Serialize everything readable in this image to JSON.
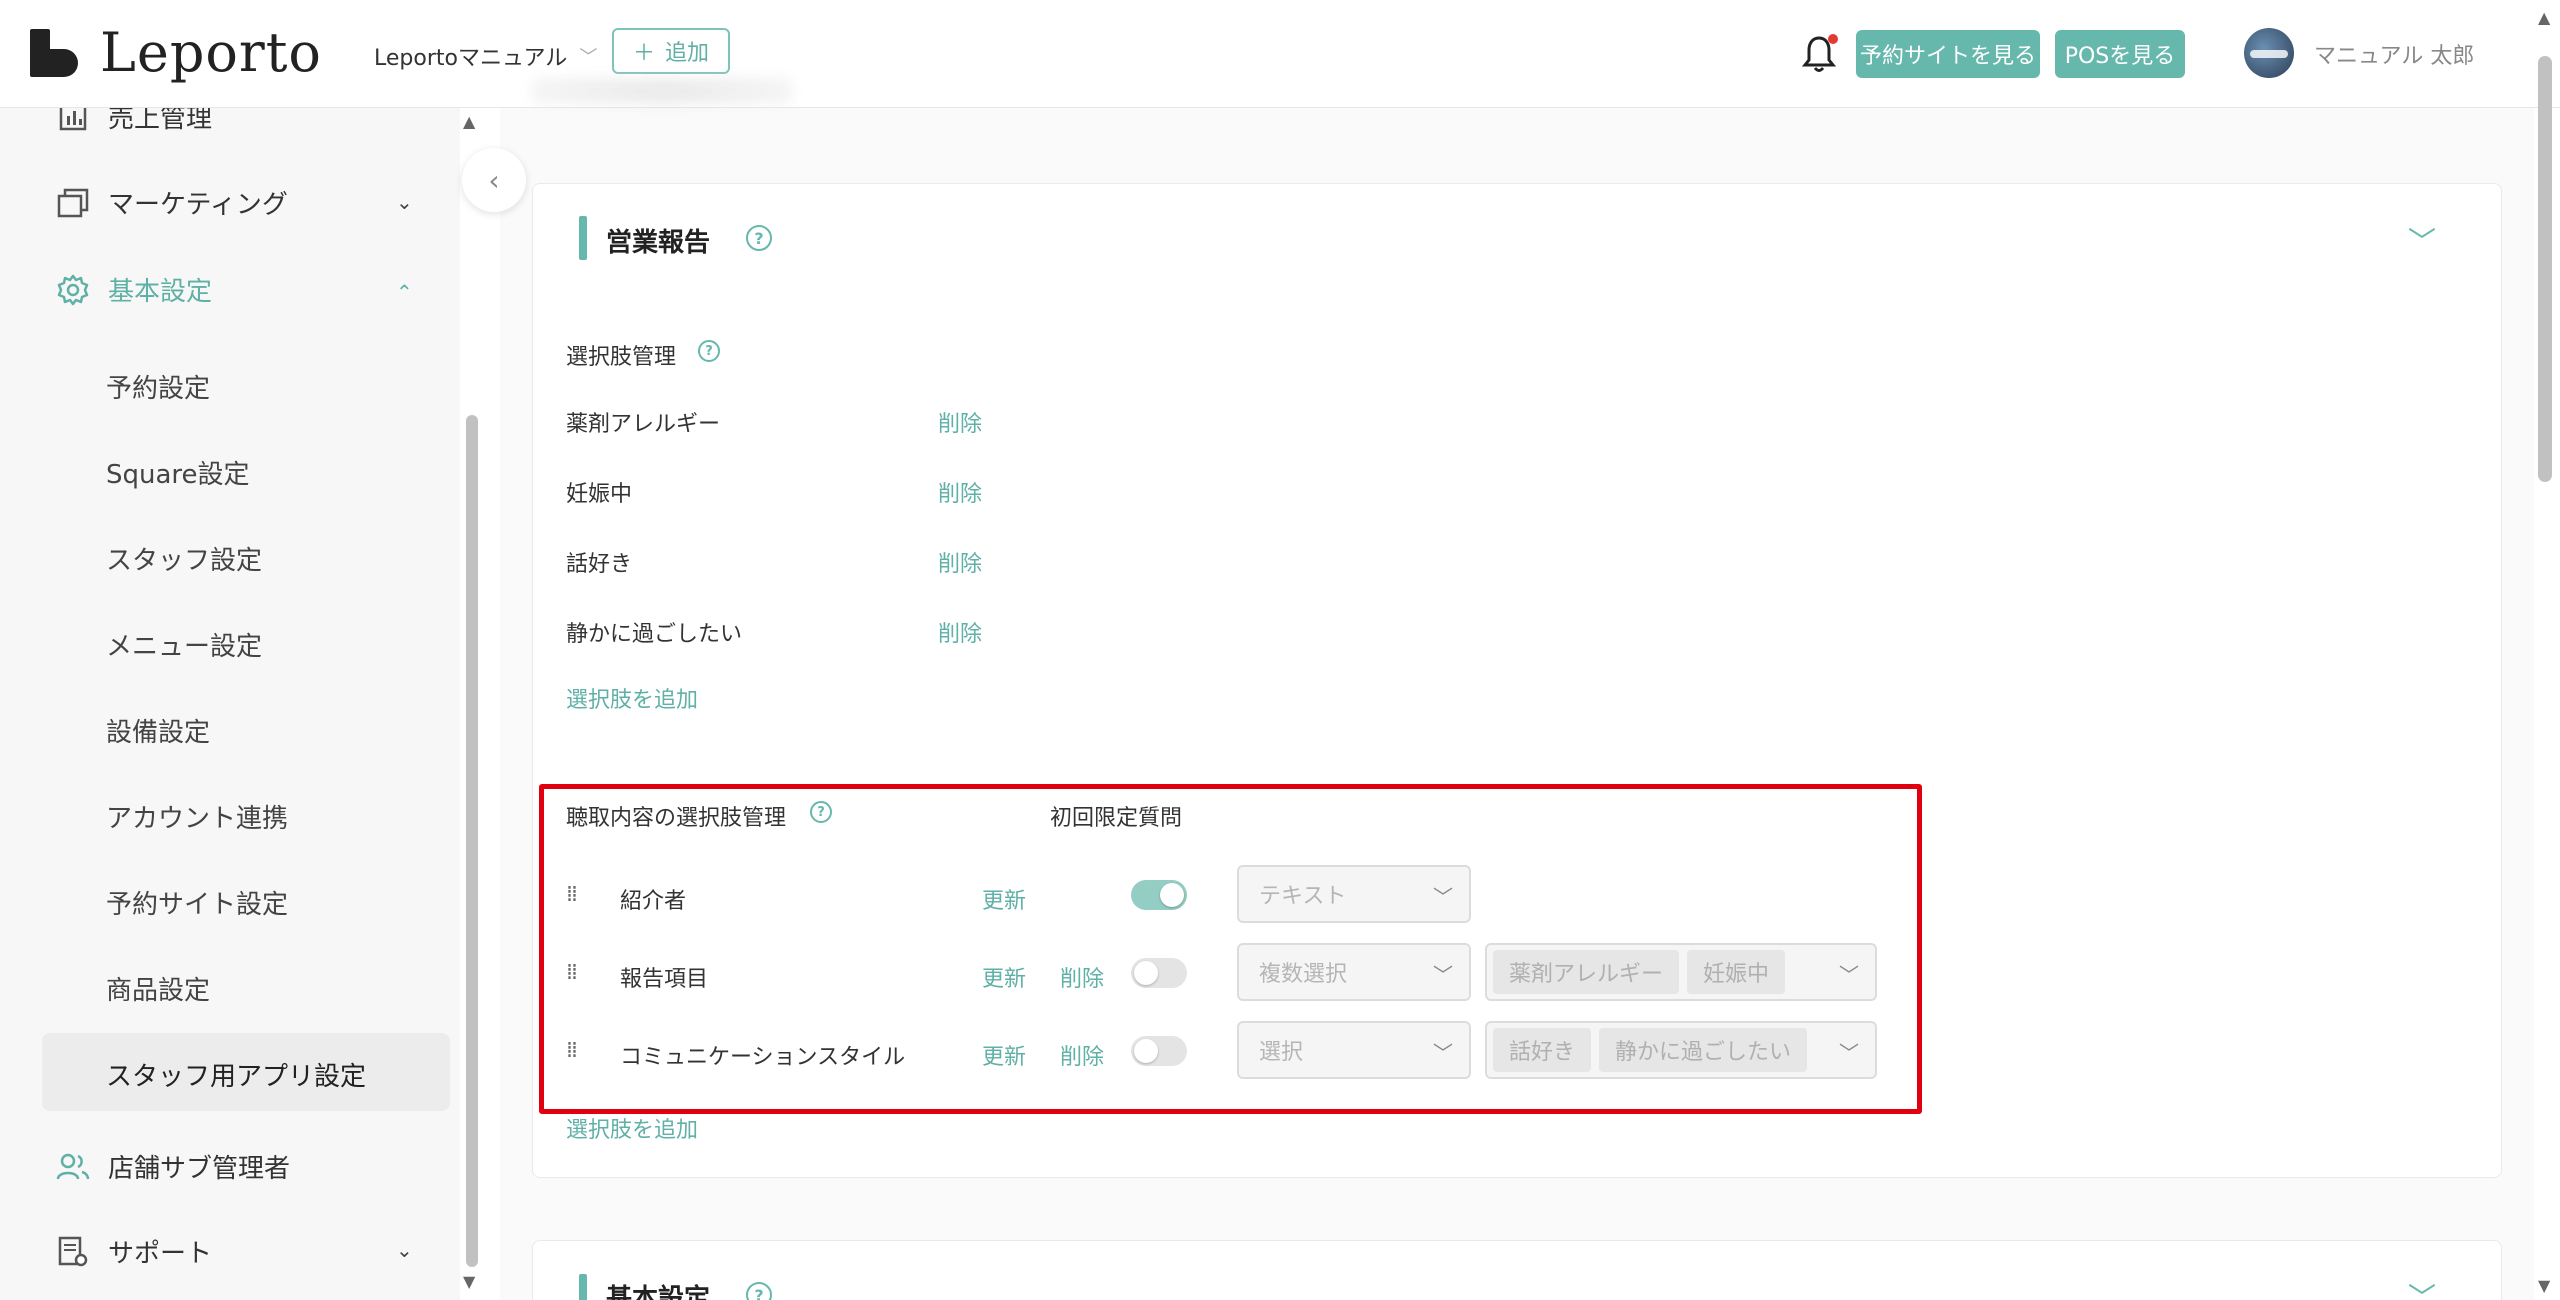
{
  "header": {
    "logo_text": "Leporto",
    "store_name": "Leportoマニュアル",
    "add_label": "追加",
    "site_button": "予約サイトを見る",
    "pos_button": "POSを見る",
    "user_name": "マニュアル 太郎"
  },
  "sidebar": {
    "items": [
      {
        "label": "売上管理"
      },
      {
        "label": "マーケティング"
      },
      {
        "label": "基本設定"
      },
      {
        "label": "店舗サブ管理者"
      },
      {
        "label": "サポート"
      }
    ],
    "sub_items": [
      {
        "label": "予約設定"
      },
      {
        "label": "Square設定"
      },
      {
        "label": "スタッフ設定"
      },
      {
        "label": "メニュー設定"
      },
      {
        "label": "設備設定"
      },
      {
        "label": "アカウント連携"
      },
      {
        "label": "予約サイト設定"
      },
      {
        "label": "商品設定"
      },
      {
        "label": "スタッフ用アプリ設定"
      }
    ]
  },
  "report_section": {
    "title": "営業報告",
    "choices_label": "選択肢管理",
    "choices": [
      {
        "label": "薬剤アレルギー",
        "delete": "削除"
      },
      {
        "label": "妊娠中",
        "delete": "削除"
      },
      {
        "label": "話好き",
        "delete": "削除"
      },
      {
        "label": "静かに過ごしたい",
        "delete": "削除"
      }
    ],
    "add_choice": "選択肢を追加",
    "hearing_label": "聴取内容の選択肢管理",
    "first_only_label": "初回限定質問",
    "hearing_items": [
      {
        "label": "紹介者",
        "update": "更新",
        "delete": "",
        "first_only": true,
        "type": "テキスト",
        "tags": []
      },
      {
        "label": "報告項目",
        "update": "更新",
        "delete": "削除",
        "first_only": false,
        "type": "複数選択",
        "tags": [
          "薬剤アレルギー",
          "妊娠中"
        ]
      },
      {
        "label": "コミュニケーションスタイル",
        "update": "更新",
        "delete": "削除",
        "first_only": false,
        "type": "選択",
        "tags": [
          "話好き",
          "静かに過ごしたい"
        ]
      }
    ],
    "add_hearing_choice": "選択肢を追加"
  },
  "basic_section": {
    "title": "基本設定"
  },
  "colors": {
    "accent": "#66b8ad",
    "highlight_box": "#e00010"
  }
}
